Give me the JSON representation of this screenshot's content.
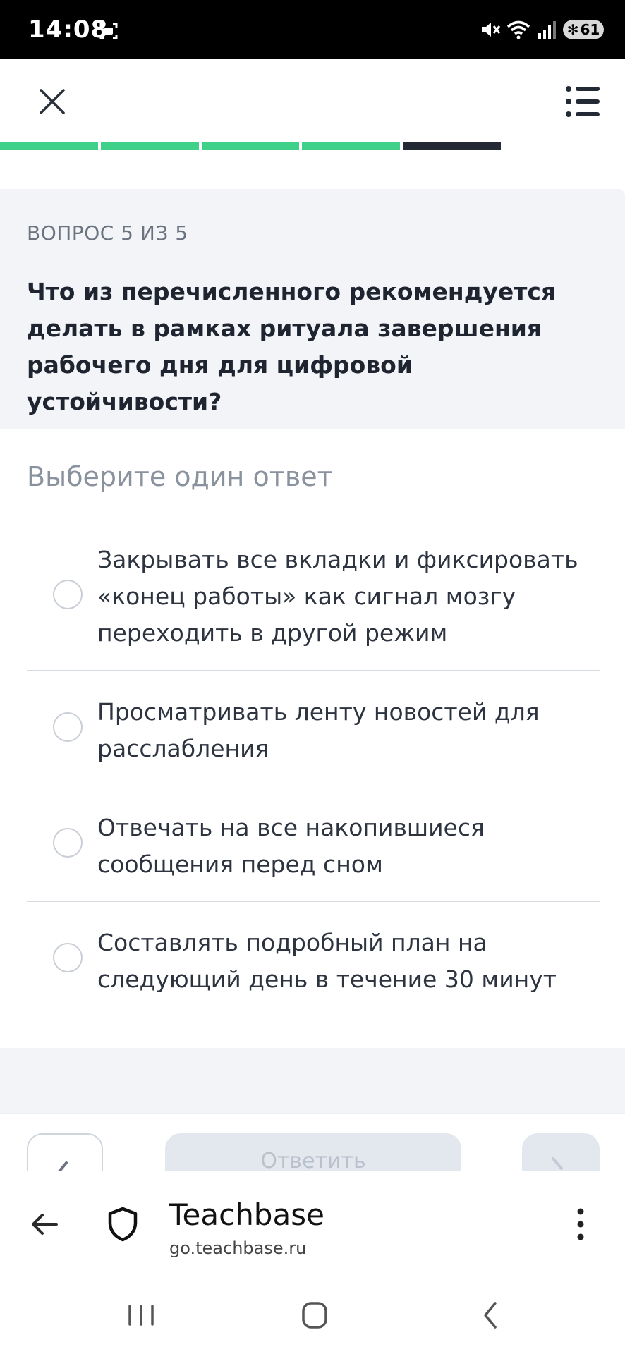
{
  "status_bar": {
    "time": "14:08",
    "battery": "61"
  },
  "top_bar": {
    "close_icon": "close-icon",
    "menu_icon": "list-icon"
  },
  "progress": {
    "total_segments": 5,
    "completed_segments": 4,
    "current_segment": 5,
    "completed_color": "#3fd08a",
    "current_color": "#232935"
  },
  "question": {
    "counter": "ВОПРОС 5 ИЗ 5",
    "text": "Что из перечисленного рекомендуется делать в рамках ритуала завершения рабочего дня для цифровой устойчивости?"
  },
  "instruction": "Выберите один ответ",
  "options": [
    {
      "label": "Закрывать все вкладки и фиксировать «конец работы» как сигнал мозгу переходить в другой режим",
      "selected": false
    },
    {
      "label": "Просматривать ленту новостей для расслабления",
      "selected": false
    },
    {
      "label": "Отвечать на все накопившиеся сообщения перед сном",
      "selected": false
    },
    {
      "label": "Составлять подробный план на следующий день в течение 30 минут",
      "selected": false
    }
  ],
  "actions": {
    "submit_label": "Ответить"
  },
  "browser": {
    "site_title": "Teachbase",
    "site_url": "go.teachbase.ru"
  }
}
